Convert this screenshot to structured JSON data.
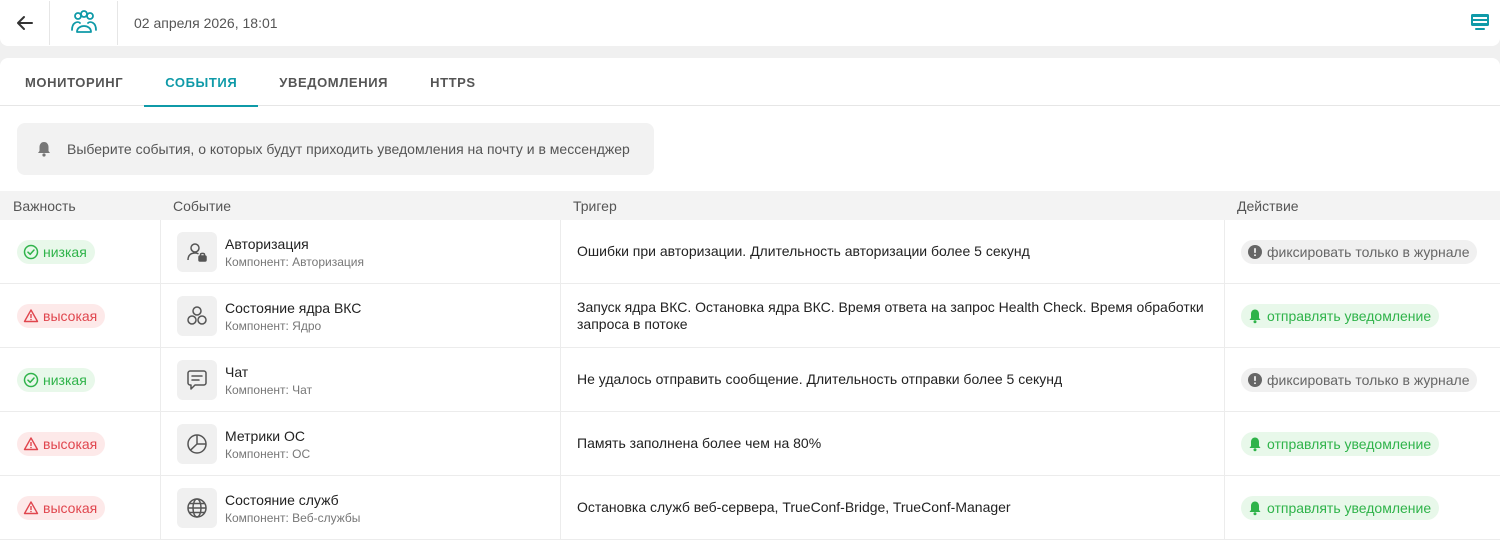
{
  "header": {
    "datetime": "02 апреля 2026, 18:01",
    "back_icon": "arrow-left-icon",
    "logo_icon": "trueconf-logo-icon",
    "right_icon": "monitor-icon"
  },
  "tabs": [
    {
      "label": "МОНИТОРИНГ",
      "active": false
    },
    {
      "label": "СОБЫТИЯ",
      "active": true
    },
    {
      "label": "УВЕДОМЛЕНИЯ",
      "active": false
    },
    {
      "label": "HTTPS",
      "active": false
    }
  ],
  "info": {
    "icon": "bell-icon",
    "text": "Выберите события, о которых будут приходить уведомления на почту и в мессенджер"
  },
  "table": {
    "headers": {
      "importance": "Важность",
      "event": "Событие",
      "trigger": "Тригер",
      "action": "Действие"
    },
    "rows": [
      {
        "importance": "низкая",
        "level": "low",
        "event_icon": "user-lock-icon",
        "event": "Авторизация",
        "component": "Компонент: Авторизация",
        "trigger": "Ошибки при авторизации. Длительность авторизации более 5 секунд",
        "action": "фиксировать только в журнале",
        "action_type": "log"
      },
      {
        "importance": "высокая",
        "level": "high",
        "event_icon": "circles-icon",
        "event": "Состояние ядра ВКС",
        "component": "Компонент: Ядро",
        "trigger": "Запуск ядра ВКС. Остановка ядра ВКС. Время ответа на запрос Health Check. Время обработки запроса в потоке",
        "action": "отправлять уведомление",
        "action_type": "notify"
      },
      {
        "importance": "низкая",
        "level": "low",
        "event_icon": "chat-icon",
        "event": "Чат",
        "component": "Компонент: Чат",
        "trigger": "Не удалось отправить сообщение. Длительность отправки более 5 секунд",
        "action": "фиксировать только в журнале",
        "action_type": "log"
      },
      {
        "importance": "высокая",
        "level": "high",
        "event_icon": "pie-chart-icon",
        "event": "Метрики ОС",
        "component": "Компонент: ОС",
        "trigger": "Память заполнена более чем на 80%",
        "action": "отправлять уведомление",
        "action_type": "notify"
      },
      {
        "importance": "высокая",
        "level": "high",
        "event_icon": "globe-icon",
        "event": "Состояние служб",
        "component": "Компонент: Веб-службы",
        "trigger": "Остановка служб веб-сервера, TrueConf-Bridge, TrueConf-Manager",
        "action": "отправлять уведомление",
        "action_type": "notify"
      }
    ]
  },
  "colors": {
    "accent": "#0f9aa8",
    "low": "#2fb34a",
    "high": "#e0464e",
    "log": "#666666"
  }
}
